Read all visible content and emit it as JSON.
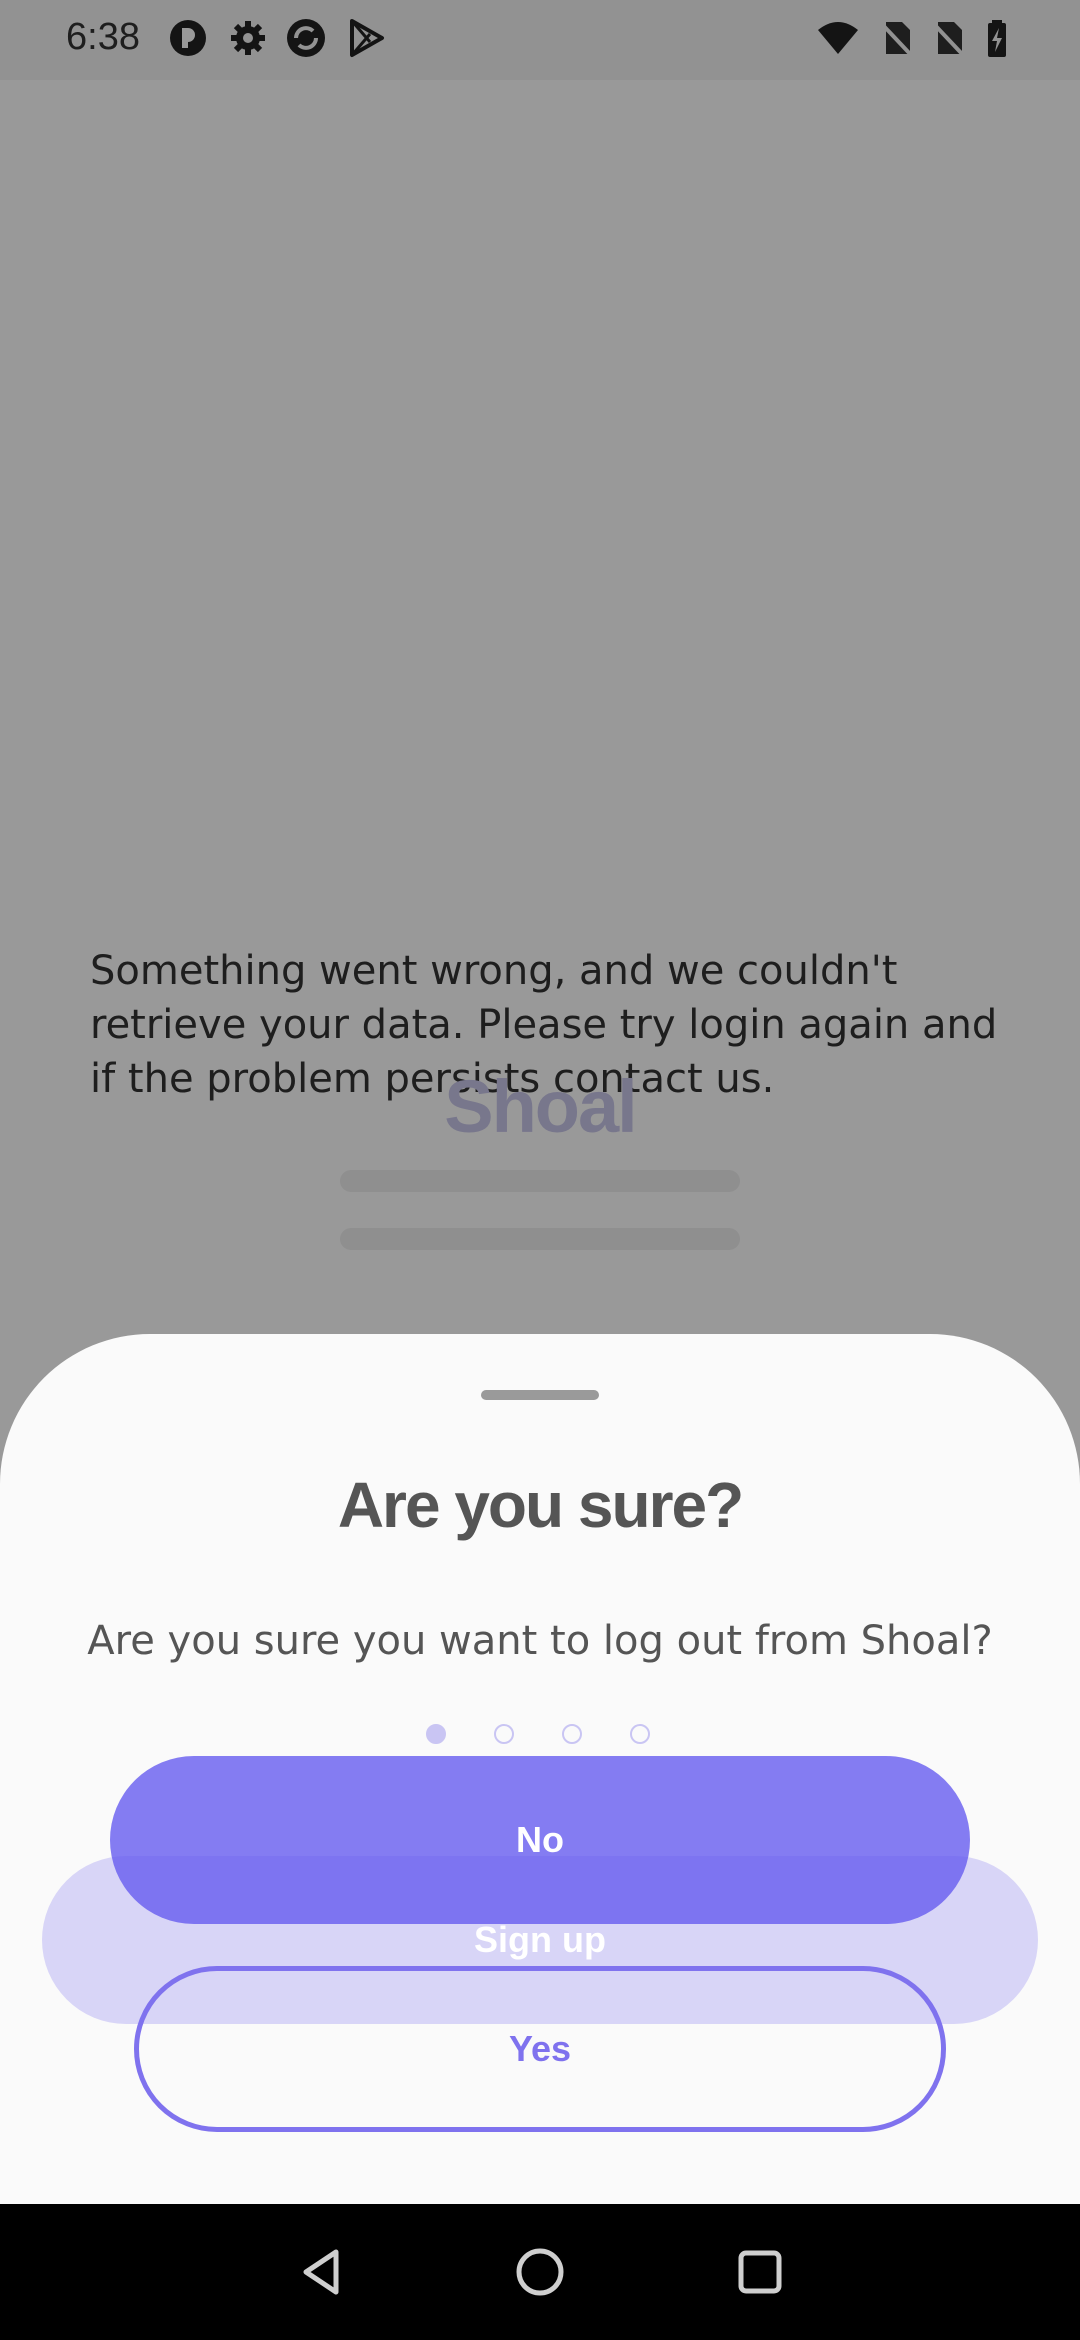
{
  "status_bar": {
    "time": "6:38",
    "icons_left": [
      "app-notification-icon",
      "settings-gear-icon",
      "sync-icon",
      "play-store-icon"
    ],
    "icons_right": [
      "wifi-icon",
      "no-sim-icon",
      "no-sim-icon",
      "battery-charging-icon"
    ]
  },
  "background": {
    "error_message": "Something went wrong, and we couldn't retrieve your data. Please try login again and if the problem persists contact us.",
    "brand_name": "Shoal"
  },
  "sheet": {
    "title": "Are you sure?",
    "message": "Are you sure you want to log out from Shoal?",
    "pager": {
      "count": 4,
      "active_index": 0
    },
    "no_label": "No",
    "signup_label": "Sign up",
    "yes_label": "Yes"
  },
  "colors": {
    "accent": "#6358f0",
    "accent_light": "#d8d5f7",
    "outline": "#7f72ee"
  },
  "nav_bar": {
    "buttons": [
      "back-icon",
      "home-icon",
      "recents-icon"
    ]
  }
}
